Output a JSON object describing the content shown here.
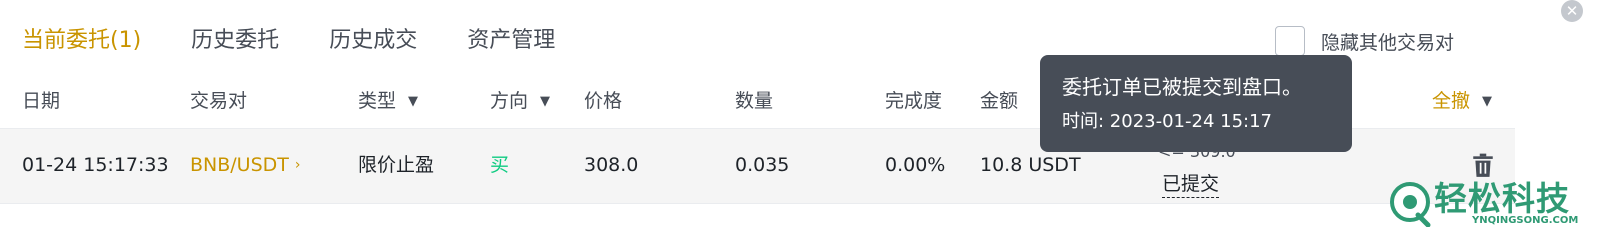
{
  "tabs": [
    {
      "label": "当前委托(1)",
      "active": true
    },
    {
      "label": "历史委托",
      "active": false
    },
    {
      "label": "历史成交",
      "active": false
    },
    {
      "label": "资产管理",
      "active": false
    }
  ],
  "hide_other_pairs": {
    "label": "隐藏其他交易对",
    "checked": false
  },
  "columns": {
    "date": "日期",
    "pair": "交易对",
    "type": "类型",
    "side": "方向",
    "price": "价格",
    "amount": "数量",
    "filled": "完成度",
    "total": "金额",
    "cancel_all": "全撤"
  },
  "order": {
    "date": "01-24 15:17:33",
    "pair": "BNB/USDT",
    "pair_chevron": "›",
    "type": "限价止盈",
    "side": "买",
    "price": "308.0",
    "amount": "0.035",
    "filled": "0.00%",
    "total": "10.8 USDT",
    "trigger_partial": "<= 309.0",
    "status": "已提交"
  },
  "tooltip": {
    "title": "委托订单已被提交到盘口。",
    "time": "时间: 2023-01-24 15:17"
  },
  "watermark": {
    "title": "轻松科技",
    "subtitle": "YNQINGSONG.COM"
  },
  "colors": {
    "accent": "#c99400",
    "buy": "#0ecb81",
    "tooltip_bg": "#474d57",
    "watermark": "#2f9a74"
  },
  "icons": {
    "close": "close-icon",
    "caret": "caret-down-icon",
    "delete": "trash-icon"
  }
}
